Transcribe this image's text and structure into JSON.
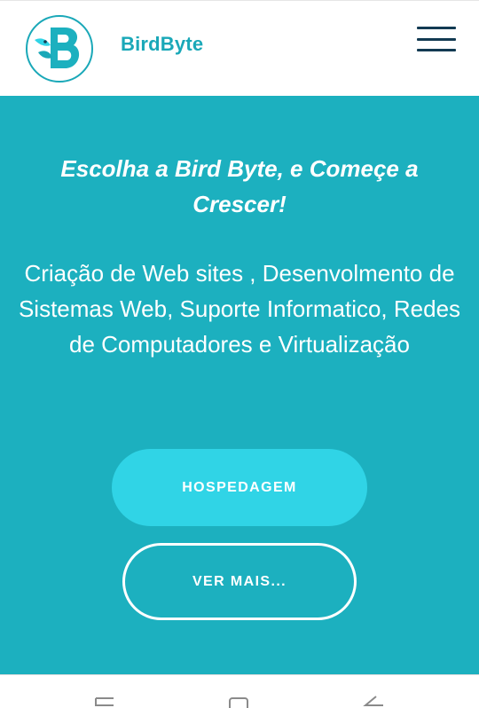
{
  "header": {
    "brand": "BirdByte",
    "logo_icon": "bird-b-logo-icon",
    "menu_icon": "hamburger-menu-icon"
  },
  "hero": {
    "title": "Escolha a Bird Byte, e Começe a Crescer!",
    "subtitle": "Criação de Web sites , Desenvolmento de Sistemas Web, Suporte Informatico, Redes de Computadores e Virtualização",
    "primary_button": "HOSPEDAGEM",
    "secondary_button": "VER MAIS..."
  },
  "system_nav": {
    "icons": [
      "recent-apps-icon",
      "home-icon",
      "back-icon"
    ]
  },
  "colors": {
    "brand_text": "#1aa8b8",
    "hero_background": "#1cb0bf",
    "primary_button": "#30d4e6",
    "menu_lines": "#123a52"
  }
}
